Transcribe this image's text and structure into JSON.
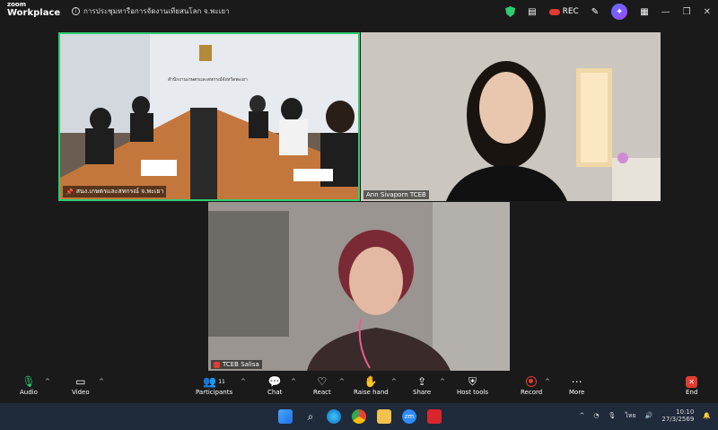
{
  "window": {
    "brand_top": "zoom",
    "brand_bottom": "Workplace",
    "meeting_title": "การประชุมหารือการจัดงานเทียสนโลก จ.พะเยา",
    "rec_label": "REC"
  },
  "participants": [
    {
      "name": "สนง.เกษตรและสหกรณ์ จ.พะเยา",
      "muted": false
    },
    {
      "name": "Ann Sivaporn TCEB",
      "muted": false
    },
    {
      "name": "TCEB Salisa",
      "muted": true
    }
  ],
  "room_sign": "สำนักงานเกษตรและสหกรณ์จังหวัดพะเยา",
  "toolbar": {
    "audio": "Audio",
    "video": "Video",
    "participants": "Participants",
    "participants_count": "11",
    "chat": "Chat",
    "react": "React",
    "raise_hand": "Raise hand",
    "share": "Share",
    "host_tools": "Host tools",
    "record": "Record",
    "more": "More",
    "end": "End"
  },
  "taskbar": {
    "language": "ไทย",
    "time": "10:10",
    "date": "27/3/2569"
  },
  "colors": {
    "active_speaker": "#2ecc71",
    "end_red": "#e03c31",
    "ai_accent": "#7a5cff"
  }
}
